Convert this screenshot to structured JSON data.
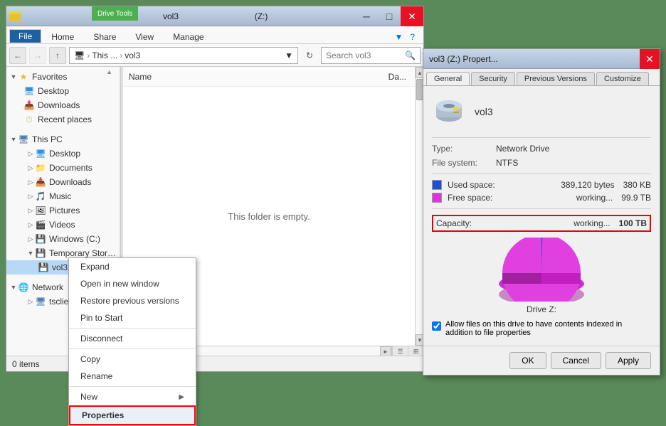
{
  "explorer": {
    "title": "vol3",
    "drive_label": "(Z:)",
    "drive_tools_badge": "Drive Tools",
    "title_full": "vol3",
    "tabs": [
      "File",
      "Home",
      "Share",
      "View",
      "Manage"
    ],
    "active_tab": "File",
    "address": {
      "back": "←",
      "forward": "→",
      "up": "↑",
      "path_parts": [
        "This ...",
        "vol3"
      ],
      "path_display": "This ... › vol3"
    },
    "search_placeholder": "Search vol3",
    "col_name": "Name",
    "col_date": "Da...",
    "content_empty": "This folder is empty.",
    "status": "0 items"
  },
  "sidebar": {
    "favorites": {
      "label": "Favorites",
      "items": [
        {
          "id": "desktop",
          "label": "Desktop",
          "icon": "🖥"
        },
        {
          "id": "downloads",
          "label": "Downloads",
          "icon": "📥"
        },
        {
          "id": "recent",
          "label": "Recent places",
          "icon": "⏱"
        }
      ]
    },
    "this_pc": {
      "label": "This PC",
      "items": [
        {
          "id": "desktop2",
          "label": "Desktop",
          "icon": "🖥"
        },
        {
          "id": "documents",
          "label": "Documents",
          "icon": "📄"
        },
        {
          "id": "downloads2",
          "label": "Downloads",
          "icon": "📥"
        },
        {
          "id": "music",
          "label": "Music",
          "icon": "🎵"
        },
        {
          "id": "pictures",
          "label": "Pictures",
          "icon": "🖼"
        },
        {
          "id": "videos",
          "label": "Videos",
          "icon": "🎬"
        },
        {
          "id": "windows_c",
          "label": "Windows (C:)",
          "icon": "💾"
        },
        {
          "id": "temp_d",
          "label": "Temporary Storage (D:)",
          "icon": "💾"
        },
        {
          "id": "vol3",
          "label": "vol3",
          "icon": "💾"
        }
      ]
    },
    "network": {
      "label": "Network",
      "items": [
        {
          "id": "tsclient",
          "label": "tsclient",
          "icon": "🖥"
        }
      ]
    }
  },
  "context_menu": {
    "items": [
      {
        "id": "expand",
        "label": "Expand",
        "has_sub": false
      },
      {
        "id": "open_new",
        "label": "Open in new window",
        "has_sub": false
      },
      {
        "id": "restore_versions",
        "label": "Restore previous versions",
        "has_sub": false
      },
      {
        "id": "pin_start",
        "label": "Pin to Start",
        "has_sub": false
      },
      {
        "id": "sep1",
        "type": "separator"
      },
      {
        "id": "disconnect",
        "label": "Disconnect",
        "has_sub": false
      },
      {
        "id": "sep2",
        "type": "separator"
      },
      {
        "id": "copy",
        "label": "Copy",
        "has_sub": false
      },
      {
        "id": "rename",
        "label": "Rename",
        "has_sub": false
      },
      {
        "id": "sep3",
        "type": "separator"
      },
      {
        "id": "new",
        "label": "New",
        "has_sub": true
      },
      {
        "id": "properties",
        "label": "Properties",
        "has_sub": false,
        "highlighted": true
      }
    ]
  },
  "properties": {
    "title": "vol3",
    "title_suffix": "(Z:) Propert...",
    "tabs": [
      "General",
      "Security",
      "Previous Versions",
      "Customize"
    ],
    "active_tab": "General",
    "drive_name": "vol3",
    "type_label": "Type:",
    "type_value": "Network Drive",
    "fs_label": "File system:",
    "fs_value": "NTFS",
    "used_label": "Used space:",
    "used_bytes": "389,120 bytes",
    "used_kb": "380 KB",
    "free_label": "Free space:",
    "free_bytes": "working...",
    "free_kb": "99.9 TB",
    "capacity_label": "Capacity:",
    "capacity_bytes": "working...",
    "capacity_size": "100 TB",
    "pie_label": "Drive Z:",
    "checkbox_text": "Allow files on this drive to have contents indexed in addition to file properties",
    "btn_ok": "OK",
    "btn_cancel": "Cancel",
    "btn_apply": "Apply"
  }
}
